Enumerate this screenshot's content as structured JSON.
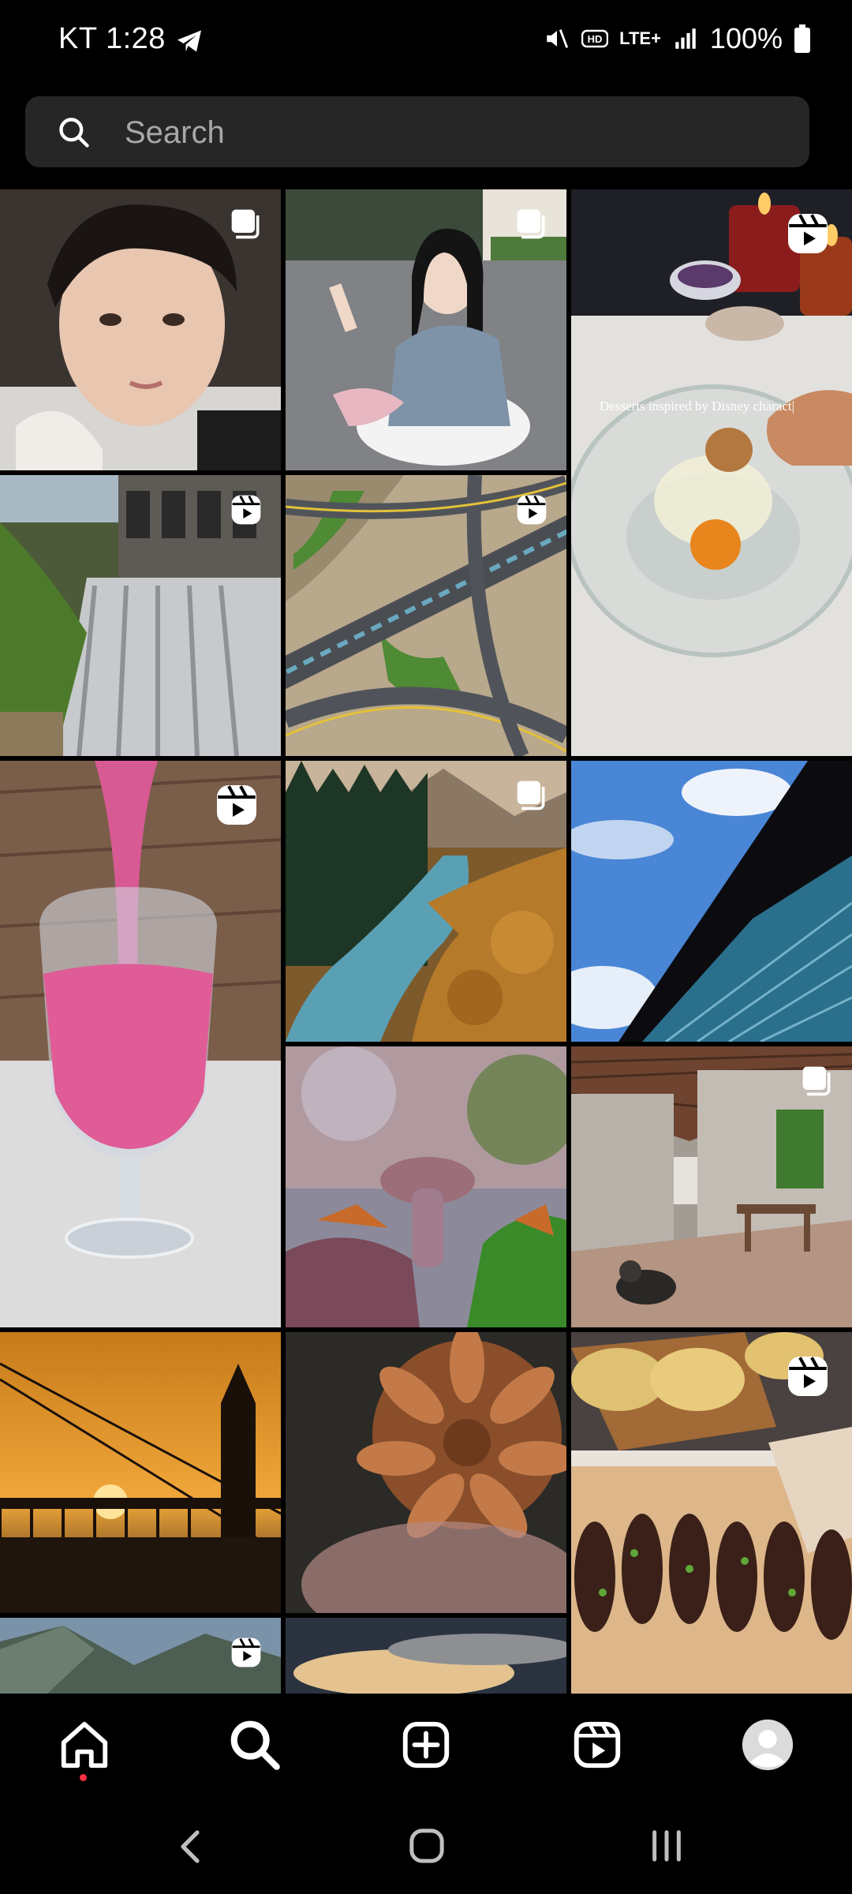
{
  "status_bar": {
    "carrier": "KT",
    "time": "1:28",
    "network": "LTE+",
    "battery": "100%"
  },
  "search": {
    "placeholder": "Search",
    "value": ""
  },
  "grid": {
    "tiles": [
      {
        "name": "portrait-young-man",
        "badge": "carousel-icon"
      },
      {
        "name": "woman-posing-table",
        "badge": "carousel-icon"
      },
      {
        "name": "dessert-egg-bowl-reel",
        "badge": "reel-icon",
        "caption": "Desserts inspired by Disney charact|"
      },
      {
        "name": "waterfall-building",
        "badge": "reel-icon"
      },
      {
        "name": "highway-interchange",
        "badge": "reel-icon"
      },
      {
        "name": "pink-smoothie-reel",
        "badge": "reel-icon"
      },
      {
        "name": "mountain-river-forest",
        "badge": "carousel-icon"
      },
      {
        "name": "blue-sky-building",
        "badge": ""
      },
      {
        "name": "mushroom-closeup",
        "badge": ""
      },
      {
        "name": "concrete-house-dog",
        "badge": "carousel-icon"
      },
      {
        "name": "sunset-bridge-tower",
        "badge": ""
      },
      {
        "name": "dahlia-flower",
        "badge": ""
      },
      {
        "name": "food-skewers-reel",
        "badge": "reel-icon"
      },
      {
        "name": "mountain-valley",
        "badge": "reel-icon"
      },
      {
        "name": "cloudy-sky",
        "badge": ""
      }
    ]
  },
  "bottom_nav": {
    "items": [
      {
        "name": "home",
        "icon": "home-icon",
        "notification_dot": true
      },
      {
        "name": "search",
        "icon": "search-icon",
        "active": true
      },
      {
        "name": "create",
        "icon": "plus-square-icon"
      },
      {
        "name": "reels",
        "icon": "reels-icon"
      },
      {
        "name": "profile",
        "icon": "avatar-icon"
      }
    ]
  },
  "system_nav": {
    "items": [
      "back",
      "home",
      "recents"
    ]
  }
}
